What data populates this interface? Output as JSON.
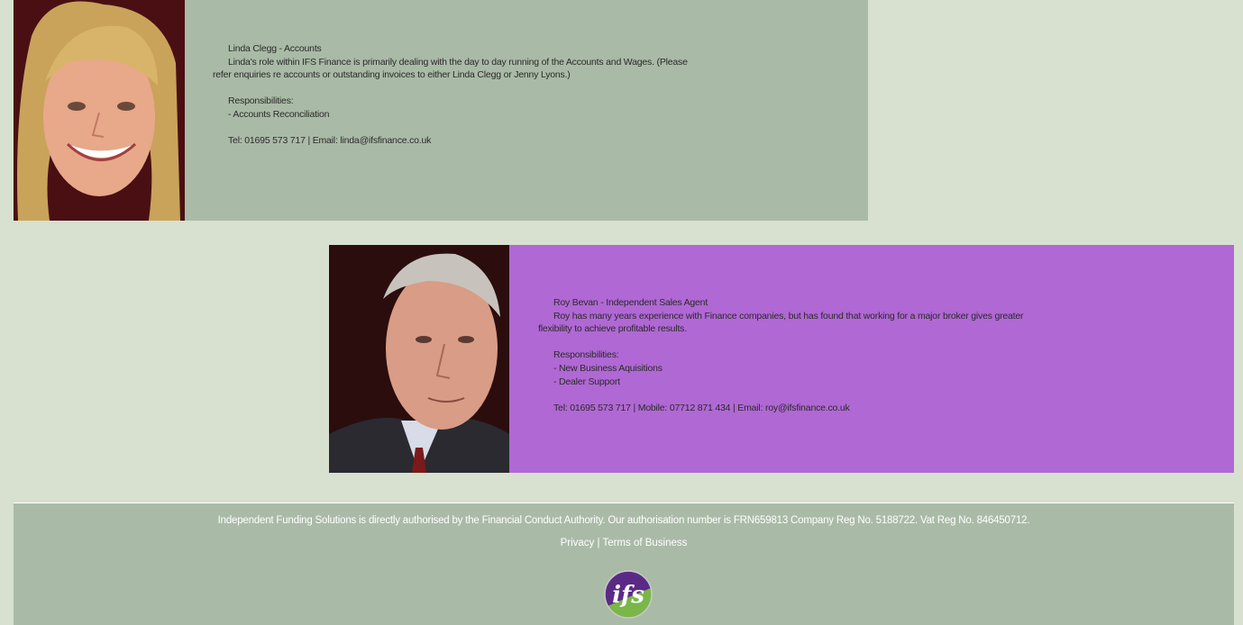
{
  "team": [
    {
      "name_role": "Linda Clegg - Accounts",
      "description_line1": "Linda's role within IFS Finance is primarily dealing with the day to day running of the Accounts and Wages. (Please",
      "description_line2": "refer enquiries re accounts or outstanding invoices to either Linda Clegg or Jenny Lyons.)",
      "responsibilities_heading": "Responsibilities:",
      "responsibilities": [
        "- Accounts Reconciliation"
      ],
      "contact": "Tel: 01695 573 717 | Email: linda@ifsfinance.co.uk",
      "card_color": "#a9bba6"
    },
    {
      "name_role": "Roy Bevan - Independent Sales Agent",
      "description_line1": "Roy has many years experience with Finance companies, but has found that working for a major broker gives greater",
      "description_line2": "flexibility to achieve profitable results.",
      "responsibilities_heading": "Responsibilities:",
      "responsibilities": [
        "- New Business Aquisitions",
        "- Dealer Support"
      ],
      "contact": "Tel: 01695 573 717 | Mobile: 07712 871 434 | Email: roy@ifsfinance.co.uk",
      "card_color": "#b068d4"
    }
  ],
  "footer": {
    "legal": "Independent Funding Solutions is directly authorised by the Financial Conduct Authority. Our authorisation number is FRN659813 Company Reg No. 5188722. Vat Reg No. 846450712.",
    "privacy_label": "Privacy",
    "separator": " | ",
    "terms_label": "Terms of Business",
    "logo_text": "ifs",
    "logo_icon": "ifs-logo-icon"
  },
  "colors": {
    "page_bg": "#d8e0d0",
    "green_card": "#a9bba6",
    "purple_card": "#b068d4",
    "logo_purple": "#5b2a86",
    "logo_green": "#7ab648"
  }
}
